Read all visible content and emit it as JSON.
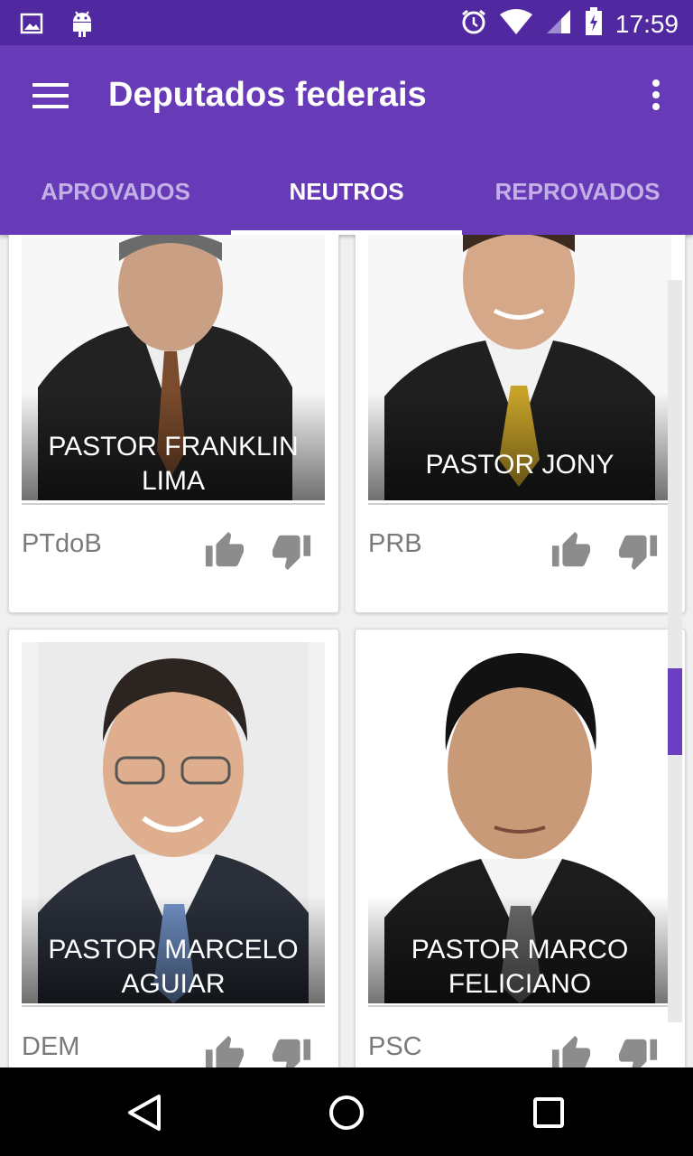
{
  "status_bar": {
    "time": "17:59",
    "icons": [
      "image-icon",
      "android-icon",
      "alarm-icon",
      "wifi-icon",
      "signal-icon",
      "battery-icon"
    ]
  },
  "app_bar": {
    "title": "Deputados federais"
  },
  "tabs": [
    {
      "label": "APROVADOS",
      "active": false
    },
    {
      "label": "NEUTROS",
      "active": true
    },
    {
      "label": "REPROVADOS",
      "active": false
    }
  ],
  "cards": [
    {
      "name": "PASTOR FRANKLIN LIMA",
      "party": "PTdoB"
    },
    {
      "name": "PASTOR JONY",
      "party": "PRB"
    },
    {
      "name": "PASTOR MARCELO AGUIAR",
      "party": "DEM"
    },
    {
      "name": "PASTOR MARCO FELICIANO",
      "party": "PSC"
    }
  ],
  "colors": {
    "primary": "#673ab7",
    "status": "#5028a0",
    "tab_inactive": "#c3b0e6",
    "icon_gray": "#8c8c8c"
  }
}
